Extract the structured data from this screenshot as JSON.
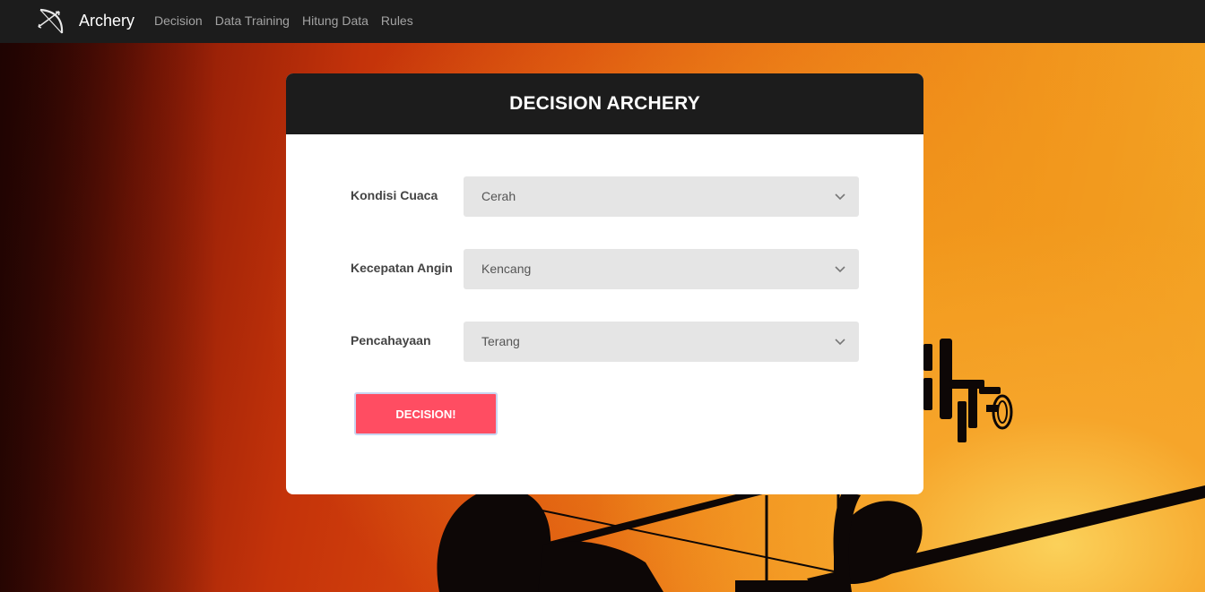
{
  "navbar": {
    "brand": "Archery",
    "brand_icon": "bow-arrow-icon",
    "links": [
      {
        "label": "Decision"
      },
      {
        "label": "Data Training"
      },
      {
        "label": "Hitung Data"
      },
      {
        "label": "Rules"
      }
    ]
  },
  "card": {
    "title": "DECISION ARCHERY",
    "fields": [
      {
        "label": "Kondisi Cuaca",
        "value": "Cerah"
      },
      {
        "label": "Kecepatan Angin",
        "value": "Kencang"
      },
      {
        "label": "Pencahayaan",
        "value": "Terang"
      }
    ],
    "submit_label": "DECISION!"
  },
  "colors": {
    "navbar_bg": "#1c1c1c",
    "button_bg": "#ff4d62",
    "select_bg": "#e5e5e5"
  }
}
